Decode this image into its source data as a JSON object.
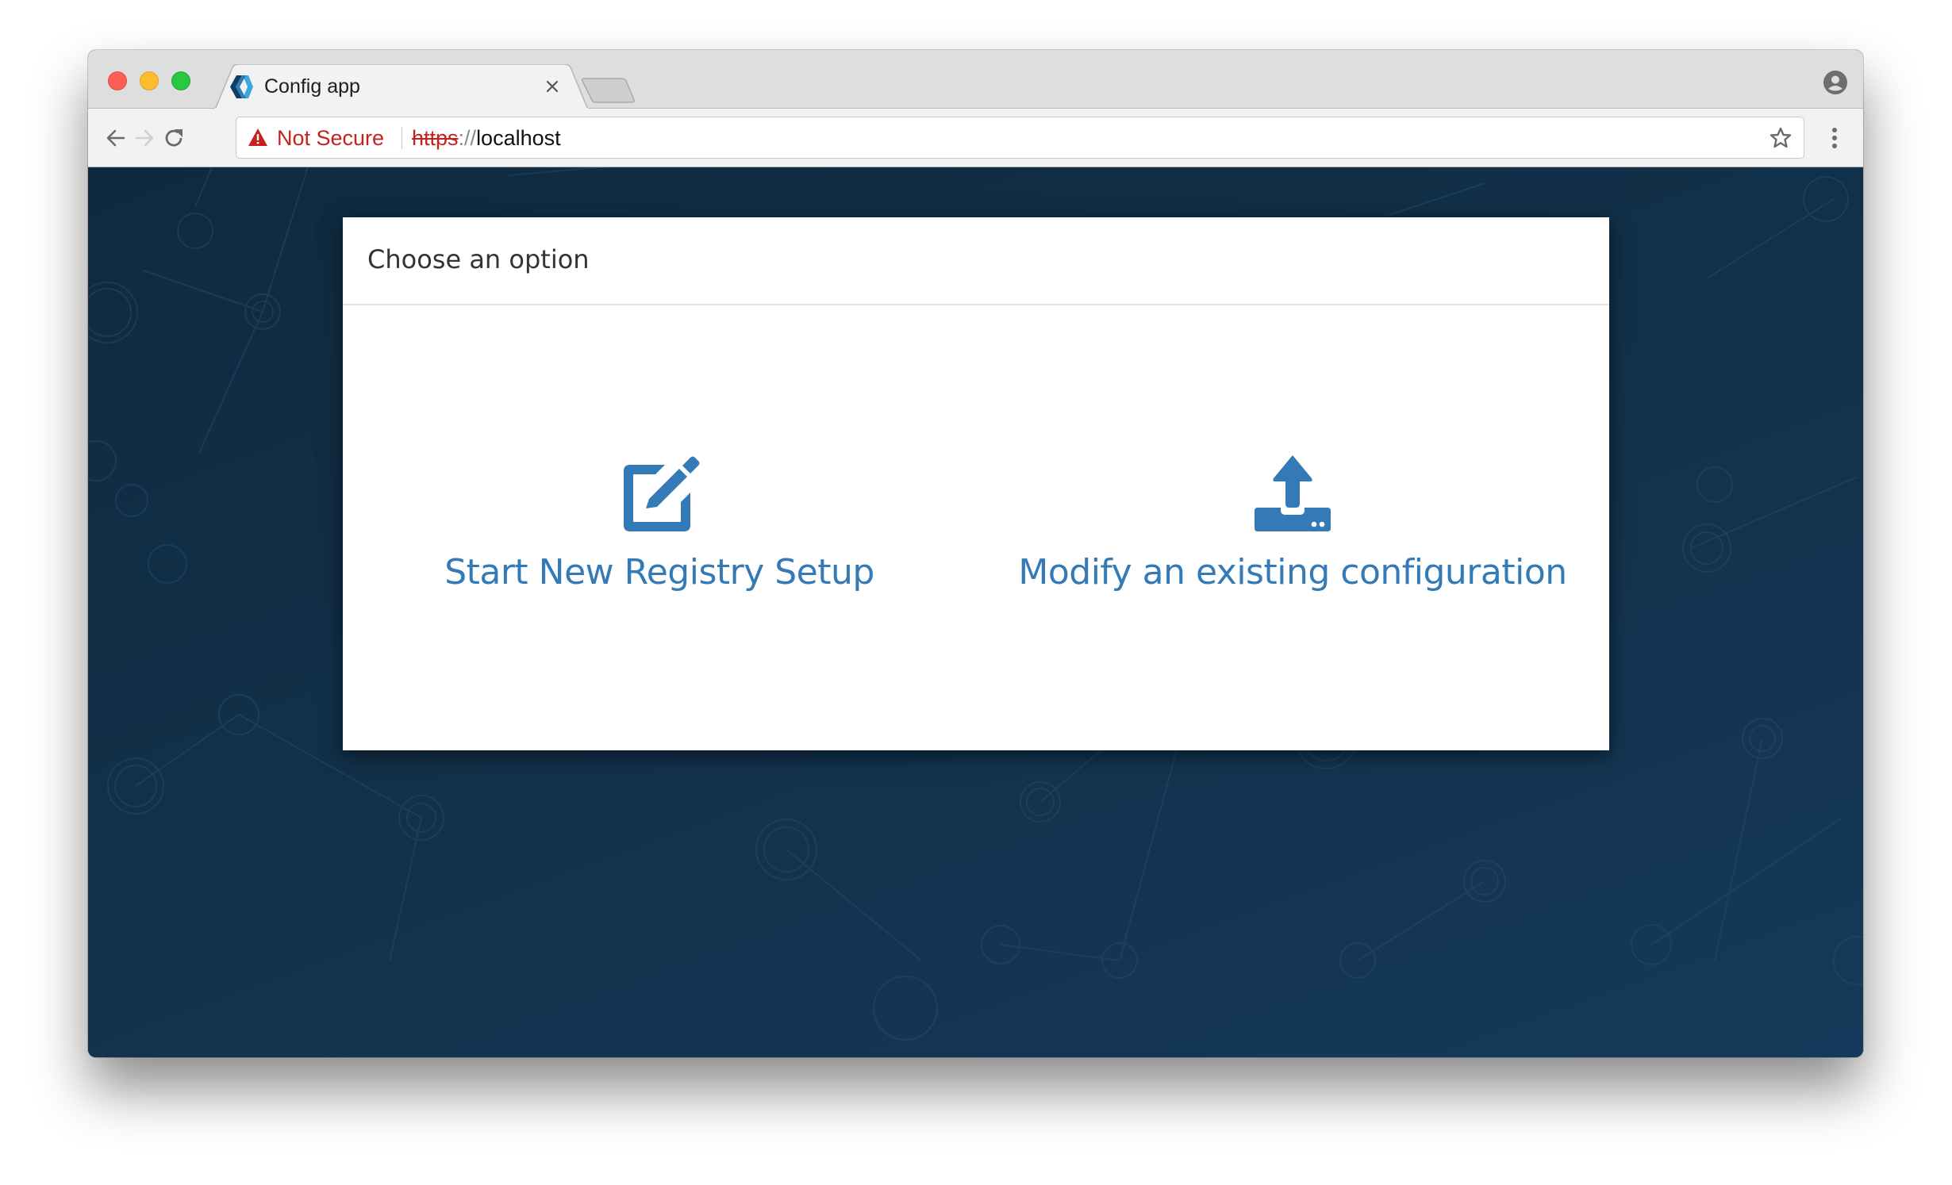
{
  "browser": {
    "tab": {
      "title": "Config app",
      "favicon": "config-app-logo-icon"
    },
    "address_bar": {
      "security_label": "Not Secure",
      "security_icon": "warning-triangle-icon",
      "url_scheme": "https",
      "url_separator": "://",
      "url_host": "localhost"
    },
    "icons": {
      "back": "arrow-left-icon",
      "forward": "arrow-right-icon",
      "reload": "reload-icon",
      "bookmark": "star-icon",
      "menu": "more-vertical-icon",
      "profile": "user-circle-icon",
      "close_tab": "close-icon"
    },
    "colors": {
      "not_secure": "#c5221f",
      "accent": "#337ab7",
      "page_background": "#112f47"
    }
  },
  "page": {
    "card": {
      "title": "Choose an option",
      "options": [
        {
          "label": "Start New Registry Setup",
          "icon": "edit-icon"
        },
        {
          "label": "Modify an existing configuration",
          "icon": "upload-icon"
        }
      ]
    }
  }
}
